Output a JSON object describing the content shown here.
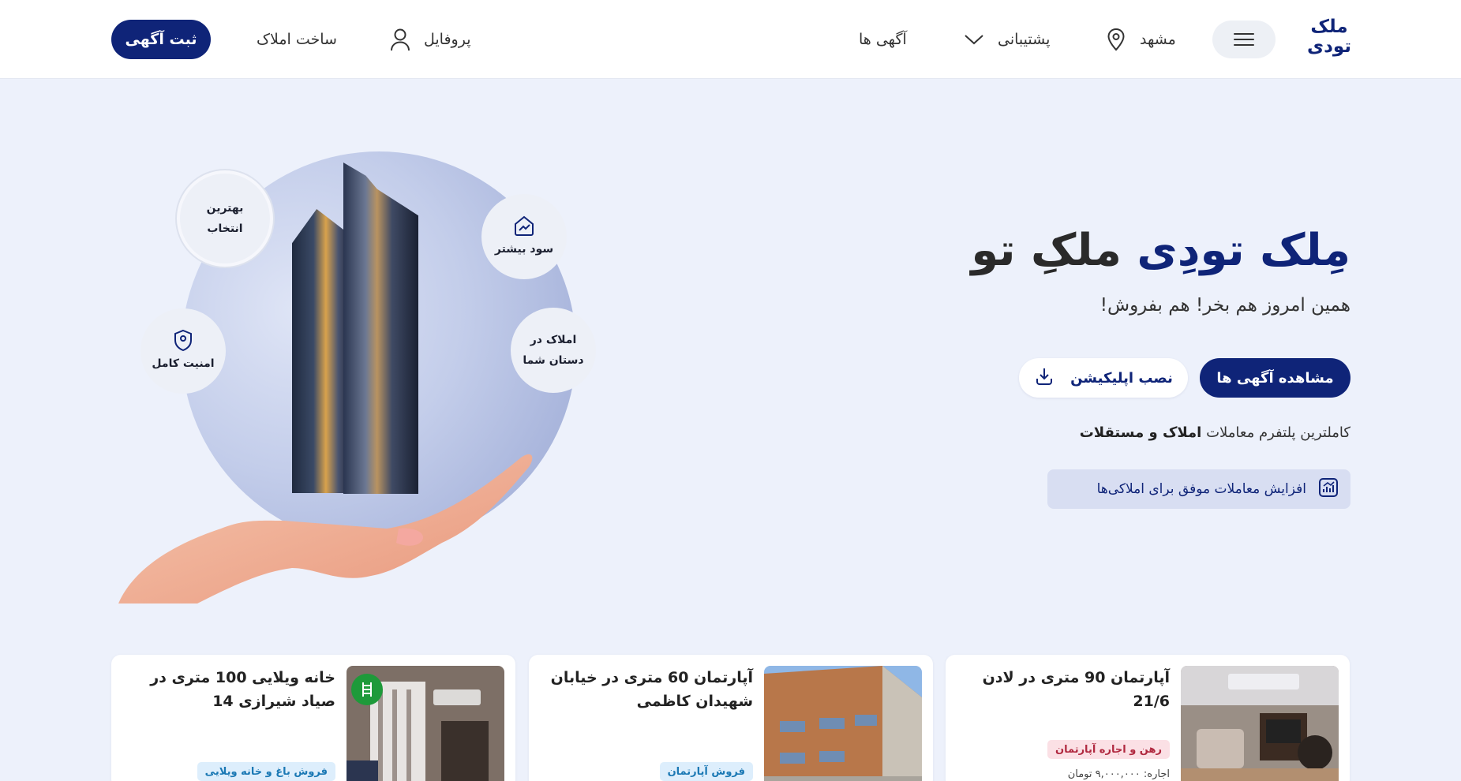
{
  "header": {
    "logo": "ملک تودی",
    "city": "مشهد",
    "support": "پشتیبانی",
    "ads": "آگهی ها",
    "profile": "پروفایل",
    "build": "ساخت املاک",
    "post_button": "ثبت آگهی"
  },
  "hero": {
    "title_blue": "مِلک تودِی",
    "title_dark": "ملکِ تو",
    "subtitle": "همین امروز هم بخر! هم بفروش!",
    "view_ads_button": "مشاهده آگهی ها",
    "install_app_button": "نصب اپلیکیشن",
    "platform_text": "کاملترین پلتفرم معاملات",
    "platform_bold": "املاک و مستقلات",
    "feature_text": "افزایش معاملات موفق برای املاکی‌ها",
    "badges": {
      "best_line1": "بهترین",
      "best_line2": "انتخاب",
      "profit": "سود بیشتر",
      "security": "امنیت کامل",
      "hands_line1": "املاک در",
      "hands_line2": "دستان شما"
    }
  },
  "listings": [
    {
      "title": "آپارتمان 90 متری در لادن 21/6",
      "tag": "رهن و اجاره آپارتمان",
      "price": "اجاره: ۹,۰۰۰,۰۰۰ تومان"
    },
    {
      "title": "آپارتمان 60 متری در خیابان شهیدان کاظمی",
      "tag": "فروش آپارتمان"
    },
    {
      "title": "خانه ویلایی 100 متری در صیاد شیرازی 14",
      "tag": "فروش باغ و خانه ویلایی"
    }
  ],
  "colors": {
    "brand": "#0f2478",
    "background": "#edf1fb",
    "tag_blue": "#1a78b4",
    "tag_red": "#b0283f",
    "green": "#1e9a3a"
  }
}
